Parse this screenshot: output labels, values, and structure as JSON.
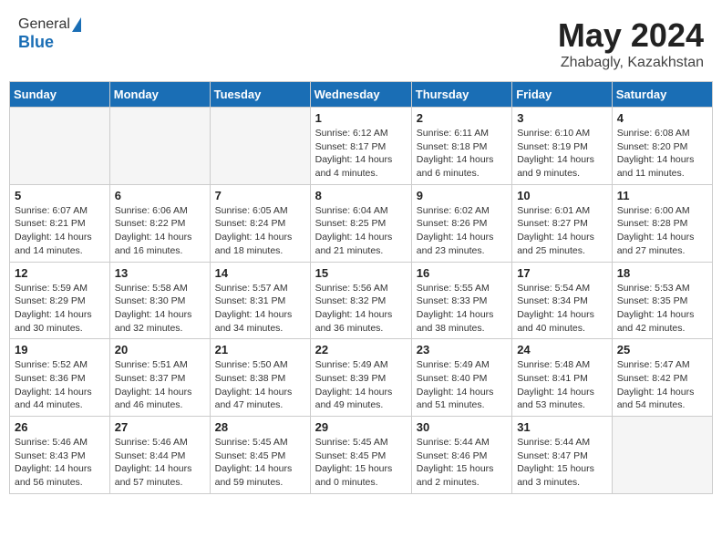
{
  "header": {
    "logo_general": "General",
    "logo_blue": "Blue",
    "title": "May 2024",
    "location": "Zhabagly, Kazakhstan"
  },
  "weekdays": [
    "Sunday",
    "Monday",
    "Tuesday",
    "Wednesday",
    "Thursday",
    "Friday",
    "Saturday"
  ],
  "weeks": [
    [
      {
        "day": "",
        "info": ""
      },
      {
        "day": "",
        "info": ""
      },
      {
        "day": "",
        "info": ""
      },
      {
        "day": "1",
        "info": "Sunrise: 6:12 AM\nSunset: 8:17 PM\nDaylight: 14 hours\nand 4 minutes."
      },
      {
        "day": "2",
        "info": "Sunrise: 6:11 AM\nSunset: 8:18 PM\nDaylight: 14 hours\nand 6 minutes."
      },
      {
        "day": "3",
        "info": "Sunrise: 6:10 AM\nSunset: 8:19 PM\nDaylight: 14 hours\nand 9 minutes."
      },
      {
        "day": "4",
        "info": "Sunrise: 6:08 AM\nSunset: 8:20 PM\nDaylight: 14 hours\nand 11 minutes."
      }
    ],
    [
      {
        "day": "5",
        "info": "Sunrise: 6:07 AM\nSunset: 8:21 PM\nDaylight: 14 hours\nand 14 minutes."
      },
      {
        "day": "6",
        "info": "Sunrise: 6:06 AM\nSunset: 8:22 PM\nDaylight: 14 hours\nand 16 minutes."
      },
      {
        "day": "7",
        "info": "Sunrise: 6:05 AM\nSunset: 8:24 PM\nDaylight: 14 hours\nand 18 minutes."
      },
      {
        "day": "8",
        "info": "Sunrise: 6:04 AM\nSunset: 8:25 PM\nDaylight: 14 hours\nand 21 minutes."
      },
      {
        "day": "9",
        "info": "Sunrise: 6:02 AM\nSunset: 8:26 PM\nDaylight: 14 hours\nand 23 minutes."
      },
      {
        "day": "10",
        "info": "Sunrise: 6:01 AM\nSunset: 8:27 PM\nDaylight: 14 hours\nand 25 minutes."
      },
      {
        "day": "11",
        "info": "Sunrise: 6:00 AM\nSunset: 8:28 PM\nDaylight: 14 hours\nand 27 minutes."
      }
    ],
    [
      {
        "day": "12",
        "info": "Sunrise: 5:59 AM\nSunset: 8:29 PM\nDaylight: 14 hours\nand 30 minutes."
      },
      {
        "day": "13",
        "info": "Sunrise: 5:58 AM\nSunset: 8:30 PM\nDaylight: 14 hours\nand 32 minutes."
      },
      {
        "day": "14",
        "info": "Sunrise: 5:57 AM\nSunset: 8:31 PM\nDaylight: 14 hours\nand 34 minutes."
      },
      {
        "day": "15",
        "info": "Sunrise: 5:56 AM\nSunset: 8:32 PM\nDaylight: 14 hours\nand 36 minutes."
      },
      {
        "day": "16",
        "info": "Sunrise: 5:55 AM\nSunset: 8:33 PM\nDaylight: 14 hours\nand 38 minutes."
      },
      {
        "day": "17",
        "info": "Sunrise: 5:54 AM\nSunset: 8:34 PM\nDaylight: 14 hours\nand 40 minutes."
      },
      {
        "day": "18",
        "info": "Sunrise: 5:53 AM\nSunset: 8:35 PM\nDaylight: 14 hours\nand 42 minutes."
      }
    ],
    [
      {
        "day": "19",
        "info": "Sunrise: 5:52 AM\nSunset: 8:36 PM\nDaylight: 14 hours\nand 44 minutes."
      },
      {
        "day": "20",
        "info": "Sunrise: 5:51 AM\nSunset: 8:37 PM\nDaylight: 14 hours\nand 46 minutes."
      },
      {
        "day": "21",
        "info": "Sunrise: 5:50 AM\nSunset: 8:38 PM\nDaylight: 14 hours\nand 47 minutes."
      },
      {
        "day": "22",
        "info": "Sunrise: 5:49 AM\nSunset: 8:39 PM\nDaylight: 14 hours\nand 49 minutes."
      },
      {
        "day": "23",
        "info": "Sunrise: 5:49 AM\nSunset: 8:40 PM\nDaylight: 14 hours\nand 51 minutes."
      },
      {
        "day": "24",
        "info": "Sunrise: 5:48 AM\nSunset: 8:41 PM\nDaylight: 14 hours\nand 53 minutes."
      },
      {
        "day": "25",
        "info": "Sunrise: 5:47 AM\nSunset: 8:42 PM\nDaylight: 14 hours\nand 54 minutes."
      }
    ],
    [
      {
        "day": "26",
        "info": "Sunrise: 5:46 AM\nSunset: 8:43 PM\nDaylight: 14 hours\nand 56 minutes."
      },
      {
        "day": "27",
        "info": "Sunrise: 5:46 AM\nSunset: 8:44 PM\nDaylight: 14 hours\nand 57 minutes."
      },
      {
        "day": "28",
        "info": "Sunrise: 5:45 AM\nSunset: 8:45 PM\nDaylight: 14 hours\nand 59 minutes."
      },
      {
        "day": "29",
        "info": "Sunrise: 5:45 AM\nSunset: 8:45 PM\nDaylight: 15 hours\nand 0 minutes."
      },
      {
        "day": "30",
        "info": "Sunrise: 5:44 AM\nSunset: 8:46 PM\nDaylight: 15 hours\nand 2 minutes."
      },
      {
        "day": "31",
        "info": "Sunrise: 5:44 AM\nSunset: 8:47 PM\nDaylight: 15 hours\nand 3 minutes."
      },
      {
        "day": "",
        "info": ""
      }
    ]
  ]
}
